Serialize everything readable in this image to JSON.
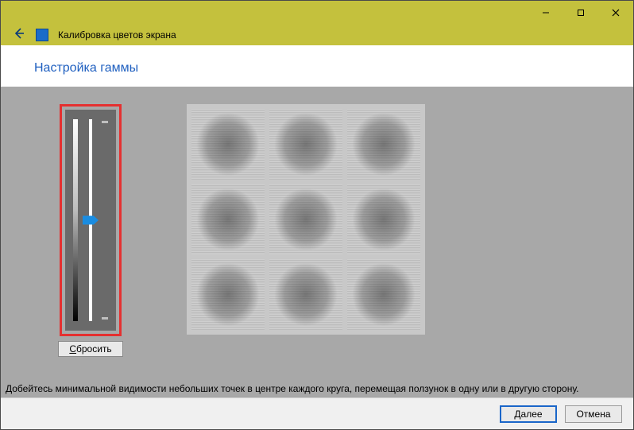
{
  "window": {
    "title": "Калибровка цветов экрана"
  },
  "page": {
    "heading": "Настройка гаммы",
    "instruction": "Добейтесь минимальной видимости небольших точек в центре каждого круга, перемещая ползунок в одну или в другую сторону."
  },
  "slider": {
    "value": 50,
    "min": 0,
    "max": 100,
    "reset_label_first": "С",
    "reset_label_rest": "бросить"
  },
  "buttons": {
    "next": "Далее",
    "cancel": "Отмена"
  },
  "colors": {
    "accent": "#1a66c9",
    "titlebar": "#c4c13d",
    "highlight": "#e53030"
  }
}
